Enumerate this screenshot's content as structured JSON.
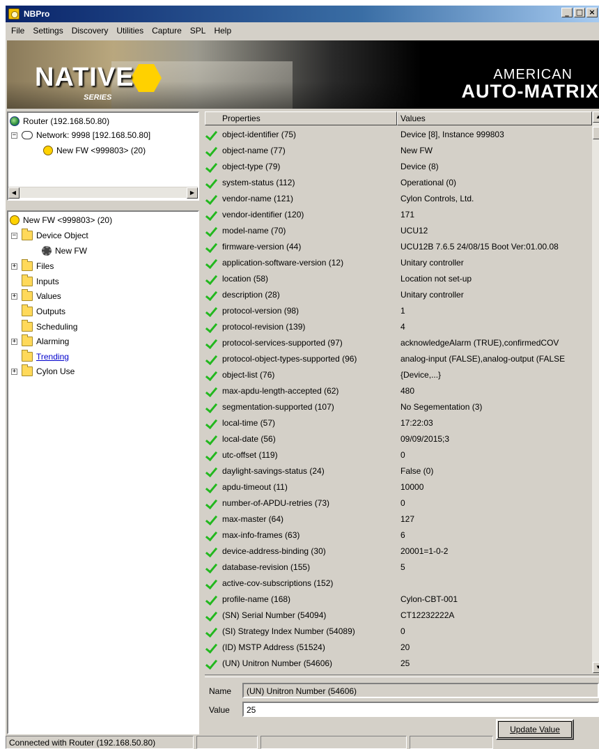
{
  "window": {
    "title": "NBPro",
    "controls": [
      "_",
      "□",
      "×"
    ]
  },
  "menu": [
    "File",
    "Settings",
    "Discovery",
    "Utilities",
    "Capture",
    "SPL",
    "Help"
  ],
  "banner": {
    "logo": "NATIVE",
    "series": "SERIES",
    "brand_line1": "AMERICAN",
    "brand_line2": "AUTO-MATRIX"
  },
  "network_tree": [
    {
      "label": "Router (192.168.50.80)",
      "icon": "globe-icon",
      "level": 0
    },
    {
      "label": "Network: 9998 [192.168.50.80]",
      "icon": "cloud-icon",
      "level": 1,
      "expander": "−"
    },
    {
      "label": "New FW <999803> (20)",
      "icon": "circle-icon",
      "level": 2
    }
  ],
  "object_tree": [
    {
      "label": "New FW <999803> (20)",
      "icon": "circle-icon",
      "level": 0
    },
    {
      "label": "Device Object",
      "icon": "folder-icon",
      "level": 1,
      "expander": "−"
    },
    {
      "label": "New FW",
      "icon": "gear-icon",
      "level": 2
    },
    {
      "label": "Files",
      "icon": "folder-icon",
      "level": 1,
      "expander": "+"
    },
    {
      "label": "Inputs",
      "icon": "folder-icon",
      "level": 1
    },
    {
      "label": "Values",
      "icon": "folder-icon",
      "level": 1,
      "expander": "+"
    },
    {
      "label": "Outputs",
      "icon": "folder-icon",
      "level": 1
    },
    {
      "label": "Scheduling",
      "icon": "folder-icon",
      "level": 1
    },
    {
      "label": "Alarming",
      "icon": "folder-icon",
      "level": 1,
      "expander": "+"
    },
    {
      "label": "Trending",
      "icon": "folder-icon",
      "level": 1,
      "link": true
    },
    {
      "label": "Cylon Use",
      "icon": "folder-icon",
      "level": 1,
      "expander": "+"
    }
  ],
  "table": {
    "headers": [
      "Properties",
      "Values"
    ],
    "rows": [
      [
        "object-identifier (75)",
        "Device [8], Instance 999803"
      ],
      [
        "object-name (77)",
        "New FW"
      ],
      [
        "object-type (79)",
        "Device (8)"
      ],
      [
        "system-status (112)",
        "Operational (0)"
      ],
      [
        "vendor-name (121)",
        "Cylon Controls, Ltd."
      ],
      [
        "vendor-identifier (120)",
        "171"
      ],
      [
        "model-name (70)",
        "UCU12"
      ],
      [
        "firmware-version (44)",
        "UCU12B 7.6.5 24/08/15 Boot Ver:01.00.08"
      ],
      [
        "application-software-version (12)",
        "Unitary controller"
      ],
      [
        "location (58)",
        "Location not set-up"
      ],
      [
        "description (28)",
        "Unitary controller"
      ],
      [
        "protocol-version (98)",
        "1"
      ],
      [
        "protocol-revision (139)",
        "4"
      ],
      [
        "protocol-services-supported (97)",
        "acknowledgeAlarm (TRUE),confirmedCOV"
      ],
      [
        "protocol-object-types-supported (96)",
        "analog-input (FALSE),analog-output (FALSE"
      ],
      [
        "object-list (76)",
        "{Device,...}"
      ],
      [
        "max-apdu-length-accepted (62)",
        "480"
      ],
      [
        "segmentation-supported (107)",
        "No Segementation (3)"
      ],
      [
        "local-time (57)",
        "17:22:03"
      ],
      [
        "local-date (56)",
        "09/09/2015;3"
      ],
      [
        "utc-offset (119)",
        "0"
      ],
      [
        "daylight-savings-status (24)",
        "False (0)"
      ],
      [
        "apdu-timeout (11)",
        "10000"
      ],
      [
        "number-of-APDU-retries (73)",
        "0"
      ],
      [
        "max-master (64)",
        "127"
      ],
      [
        "max-info-frames (63)",
        "6"
      ],
      [
        "device-address-binding (30)",
        "20001=1-0-2"
      ],
      [
        "database-revision (155)",
        "5"
      ],
      [
        "active-cov-subscriptions (152)",
        ""
      ],
      [
        "profile-name (168)",
        "Cylon-CBT-001"
      ],
      [
        "(SN) Serial Number (54094)",
        "CT12232222A"
      ],
      [
        "(SI) Strategy Index Number (54089)",
        "0"
      ],
      [
        "(ID) MSTP Address (51524)",
        "20"
      ],
      [
        "(UN) Unitron Number  (54606)",
        "25"
      ]
    ]
  },
  "editor": {
    "name_label": "Name",
    "name_value": "(UN) Unitron Number  (54606)",
    "value_label": "Value",
    "value_value": "25",
    "update_button": "Update Value"
  },
  "status_bar": {
    "text": "Connected with Router (192.168.50.80)"
  }
}
